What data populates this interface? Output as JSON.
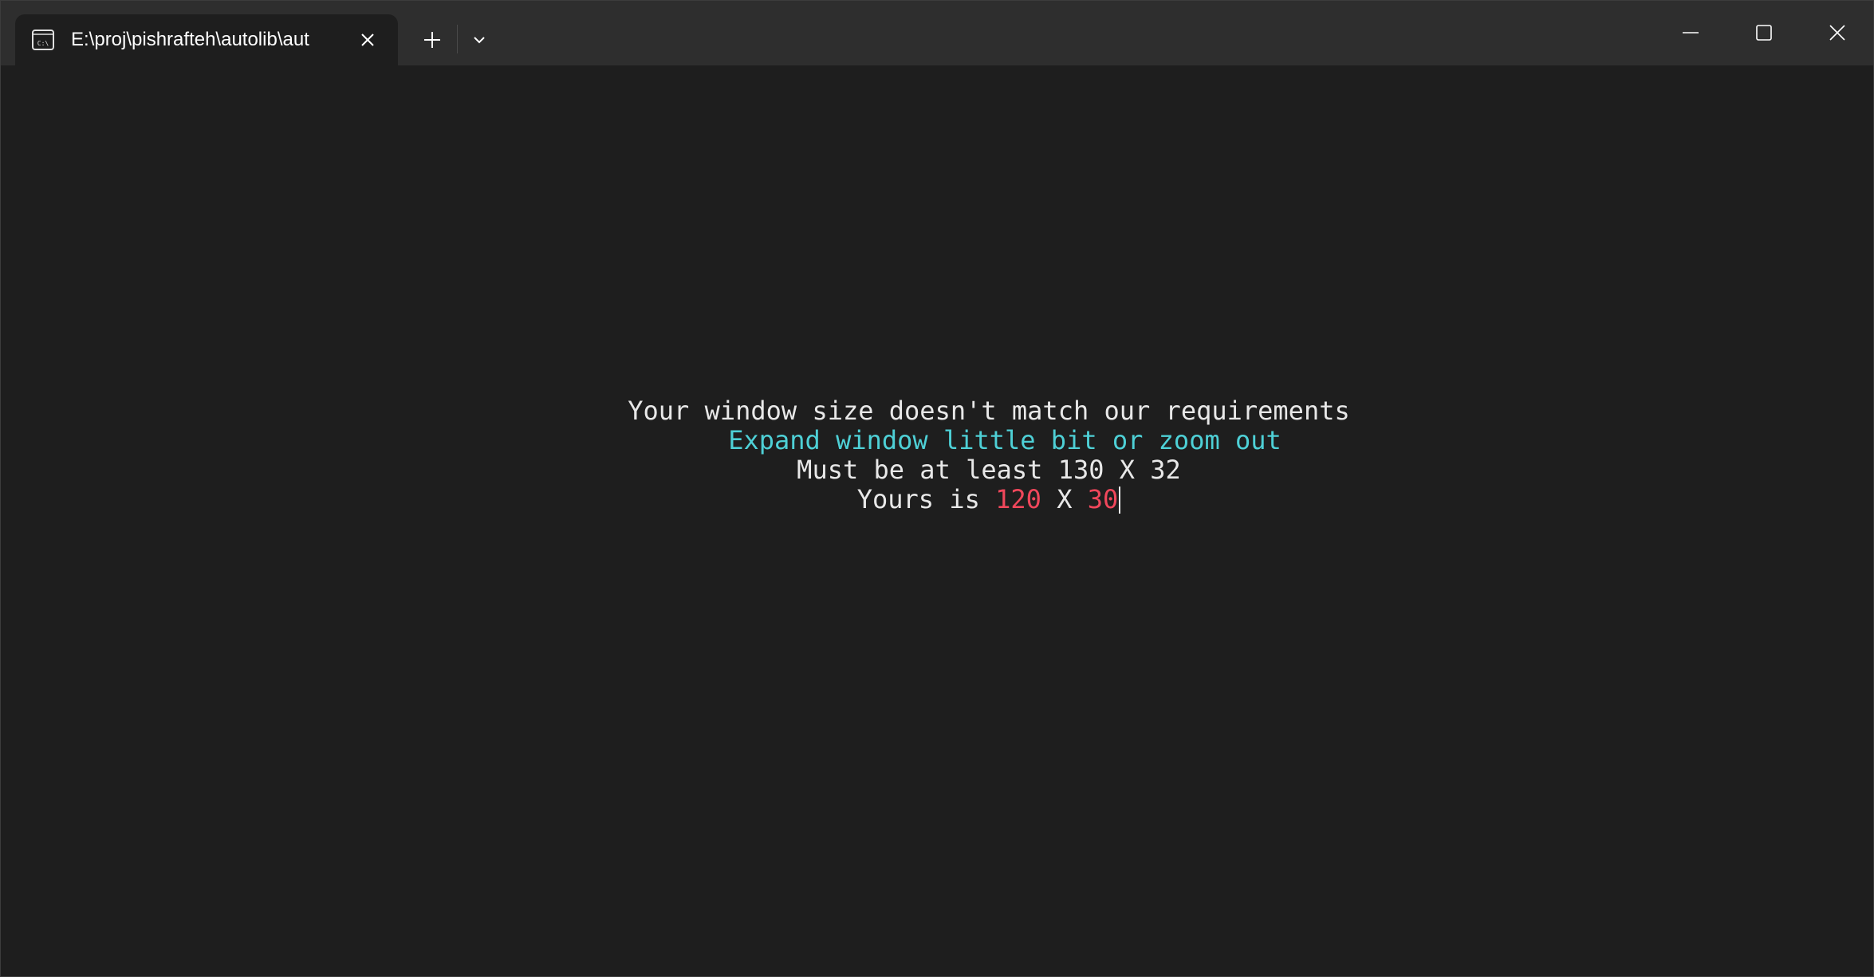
{
  "tab": {
    "title": "E:\\proj\\pishrafteh\\autolib\\aut",
    "icon": "terminal-icon"
  },
  "toolbar": {
    "new_tab_icon": "plus-icon",
    "dropdown_icon": "chevron-down-icon"
  },
  "window_controls": {
    "minimize_icon": "minimize-icon",
    "maximize_icon": "maximize-icon",
    "close_icon": "close-icon"
  },
  "terminal": {
    "line1": "Your window size doesn't match our requirements",
    "line2": "Expand window little bit or zoom out",
    "line3": "Must be at least 130 X 32",
    "line4_prefix": "Yours is ",
    "line4_width": "120",
    "line4_sep": " X ",
    "line4_height": "30"
  },
  "colors": {
    "background": "#1e1e1e",
    "titlebar": "#2e2e2e",
    "text": "#e8e8e8",
    "cyan": "#4ed0d6",
    "red": "#f0475b"
  }
}
